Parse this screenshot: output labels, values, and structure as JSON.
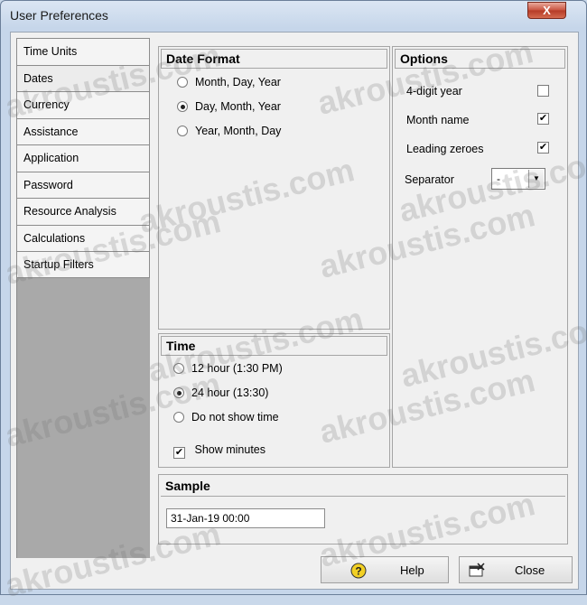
{
  "window": {
    "title": "User Preferences",
    "close_glyph": "X"
  },
  "tabs": [
    {
      "label": "Time Units"
    },
    {
      "label": "Dates"
    },
    {
      "label": "Currency"
    },
    {
      "label": "Assistance"
    },
    {
      "label": "Application"
    },
    {
      "label": "Password"
    },
    {
      "label": "Resource Analysis"
    },
    {
      "label": "Calculations"
    },
    {
      "label": "Startup Filters"
    }
  ],
  "date_format": {
    "title": "Date Format",
    "options": [
      {
        "label": "Month, Day, Year",
        "selected": false
      },
      {
        "label": "Day, Month, Year",
        "selected": true
      },
      {
        "label": "Year, Month, Day",
        "selected": false
      }
    ]
  },
  "options": {
    "title": "Options",
    "four_digit_year": {
      "label": "4-digit year",
      "checked": false
    },
    "month_name": {
      "label": "Month name",
      "checked": true
    },
    "leading_zeroes": {
      "label": "Leading zeroes",
      "checked": true
    },
    "separator": {
      "label": "Separator",
      "value": "-"
    }
  },
  "time": {
    "title": "Time",
    "options": [
      {
        "label": "12 hour (1:30 PM)",
        "selected": false
      },
      {
        "label": "24 hour (13:30)",
        "selected": true
      },
      {
        "label": "Do not show time",
        "selected": false
      }
    ],
    "show_minutes": {
      "label": "Show minutes",
      "checked": true
    }
  },
  "sample": {
    "title": "Sample",
    "value": "31-Jan-19 00:00"
  },
  "buttons": {
    "help": "Help",
    "close": "Close"
  },
  "watermark": "akroustis.com",
  "check_glyph": "✔"
}
